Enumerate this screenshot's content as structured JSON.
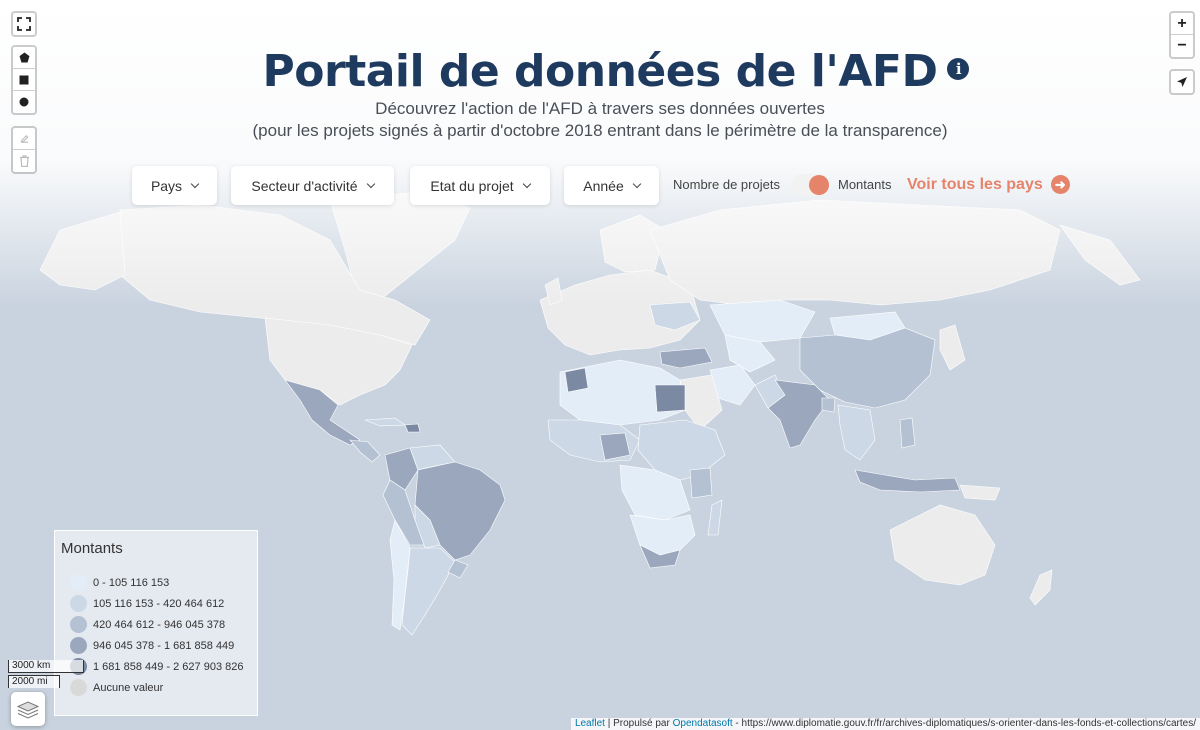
{
  "header": {
    "title": "Portail de données de l'AFD",
    "subtitle_line1": "Découvrez l'action de l'AFD à travers ses données ouvertes",
    "subtitle_line2": "(pour les projets signés à partir d'octobre 2018 entrant dans le périmètre de la transparence)"
  },
  "filters": [
    {
      "label": "Pays"
    },
    {
      "label": "Secteur d'activité"
    },
    {
      "label": "Etat du projet"
    },
    {
      "label": "Année"
    }
  ],
  "toggle": {
    "left_label": "Nombre de projets",
    "right_label": "Montants",
    "selected": "Montants"
  },
  "voir_link": "Voir tous les pays",
  "zoom": {
    "in": "+",
    "out": "−"
  },
  "legend": {
    "title": "Montants",
    "items": [
      {
        "label": "0 - 105 116 153",
        "color": "#e3edf8"
      },
      {
        "label": "105 116 153 - 420 464 612",
        "color": "#ccd8e6"
      },
      {
        "label": "420 464 612 - 946 045 378",
        "color": "#b4c1d3"
      },
      {
        "label": "946 045 378 - 1 681 858 449",
        "color": "#9aa7bd"
      },
      {
        "label": "1 681 858 449 - 2 627 903 826",
        "color": "#7b89a2"
      },
      {
        "label": "Aucune valeur",
        "color": "#d9d9d9"
      }
    ]
  },
  "scale": {
    "km": "3000 km",
    "mi": "2000 mi"
  },
  "attribution": {
    "leaflet": "Leaflet",
    "separator": " | Propulsé par ",
    "provider": "Opendatasoft",
    "source": " - https://www.diplomatie.gouv.fr/fr/archives-diplomatiques/s-orienter-dans-les-fonds-et-collections/cartes/"
  },
  "colors": {
    "ocean": "#c9d3df",
    "no_value": "#ececec",
    "accent": "#e5846a",
    "title": "#1f3a5f"
  },
  "icons": [
    "fullscreen-icon",
    "polygon-draw-icon",
    "rectangle-draw-icon",
    "circle-draw-icon",
    "edit-icon",
    "trash-icon",
    "locate-icon",
    "info-icon",
    "arrow-right-icon",
    "layers-icon"
  ]
}
